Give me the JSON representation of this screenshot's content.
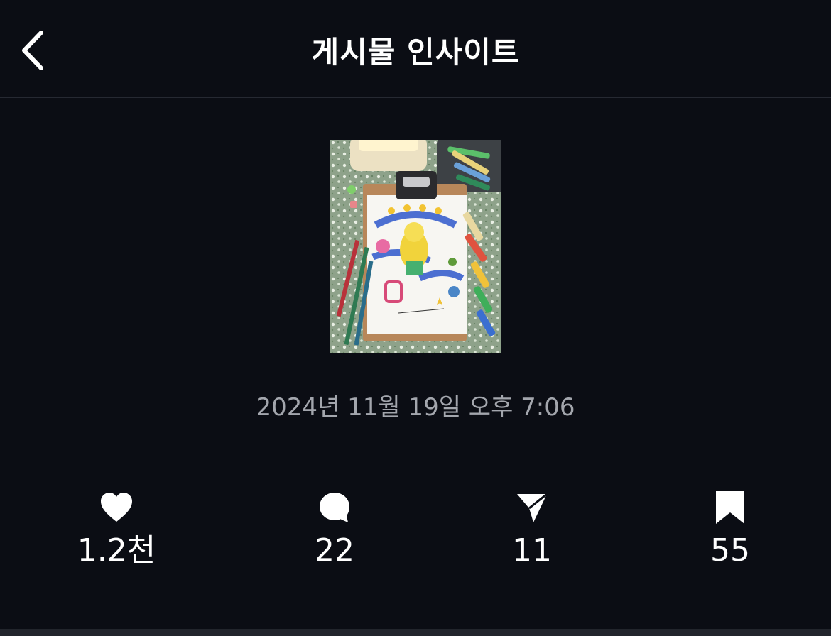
{
  "header": {
    "title": "게시물 인사이트",
    "back_icon": "chevron-left-icon"
  },
  "post": {
    "thumbnail_description": "clipboard drawing thumbnail",
    "timestamp": "2024년 11월 19일 오후 7:06"
  },
  "stats": [
    {
      "icon": "heart-icon",
      "value": "1.2천"
    },
    {
      "icon": "comment-icon",
      "value": "22"
    },
    {
      "icon": "share-icon",
      "value": "11"
    },
    {
      "icon": "bookmark-icon",
      "value": "55"
    }
  ],
  "colors": {
    "background": "#0b0d14",
    "text_primary": "#ffffff",
    "text_secondary": "#a3a6ad"
  }
}
